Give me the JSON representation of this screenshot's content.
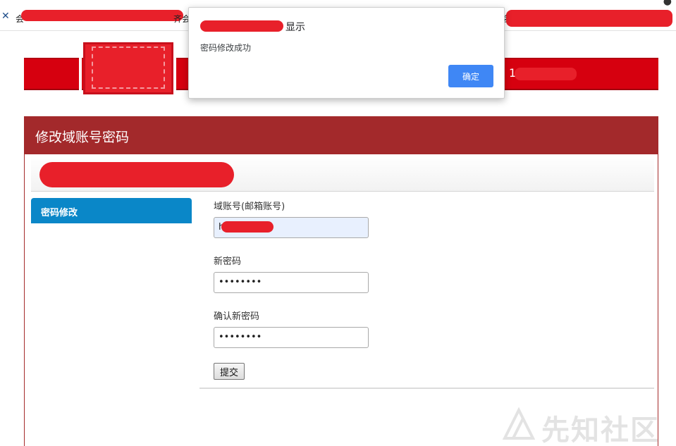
{
  "bookmarks": {
    "left_text": "会",
    "middle_text": "齐会",
    "right_text": "会"
  },
  "panel": {
    "title": "修改域账号密码"
  },
  "sidebar": {
    "active_item": "密码修改"
  },
  "form": {
    "account_label": "域账号(邮箱账号)",
    "account_value": "h",
    "new_password_label": "新密码",
    "new_password_value": "••••••••",
    "confirm_password_label": "确认新密码",
    "confirm_password_value": "••••••••",
    "submit_label": "提交"
  },
  "dialog": {
    "title_suffix": "显示",
    "message": "密码修改成功",
    "ok_label": "确定"
  },
  "banner": {
    "partial_text": "1"
  },
  "watermark": {
    "text": "先知社区"
  },
  "colors": {
    "banner_red": "#d6000f",
    "panel_header": "#a3292b",
    "sidebar_active": "#0a87c8",
    "dialog_button": "#3f87f5"
  }
}
